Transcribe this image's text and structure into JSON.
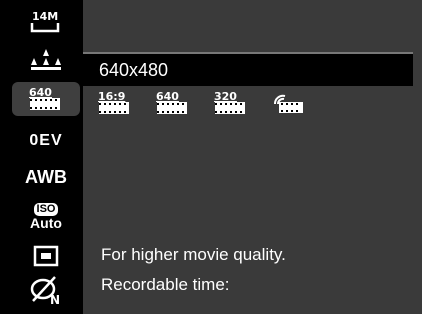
{
  "sidebar": {
    "items": [
      {
        "name": "image-size-icon",
        "text": "14M"
      },
      {
        "name": "quality-icon",
        "text": ""
      },
      {
        "name": "movie-size-icon",
        "text": "640"
      },
      {
        "name": "exposure-comp",
        "text": "0EV"
      },
      {
        "name": "white-balance",
        "text": "AWB"
      },
      {
        "name": "iso-setting",
        "text": "ISO",
        "text2": "Auto"
      },
      {
        "name": "metering-icon",
        "text": ""
      },
      {
        "name": "no-flash-icon",
        "text": "N"
      }
    ],
    "active_index": 2
  },
  "menu": {
    "title": "640x480",
    "options": [
      {
        "name": "movie-16-9",
        "label": "16:9"
      },
      {
        "name": "movie-640",
        "label": "640"
      },
      {
        "name": "movie-320",
        "label": "320"
      },
      {
        "name": "movie-web",
        "label": ""
      }
    ]
  },
  "description": {
    "line1": "For higher movie quality.",
    "line2": "Recordable time:"
  }
}
